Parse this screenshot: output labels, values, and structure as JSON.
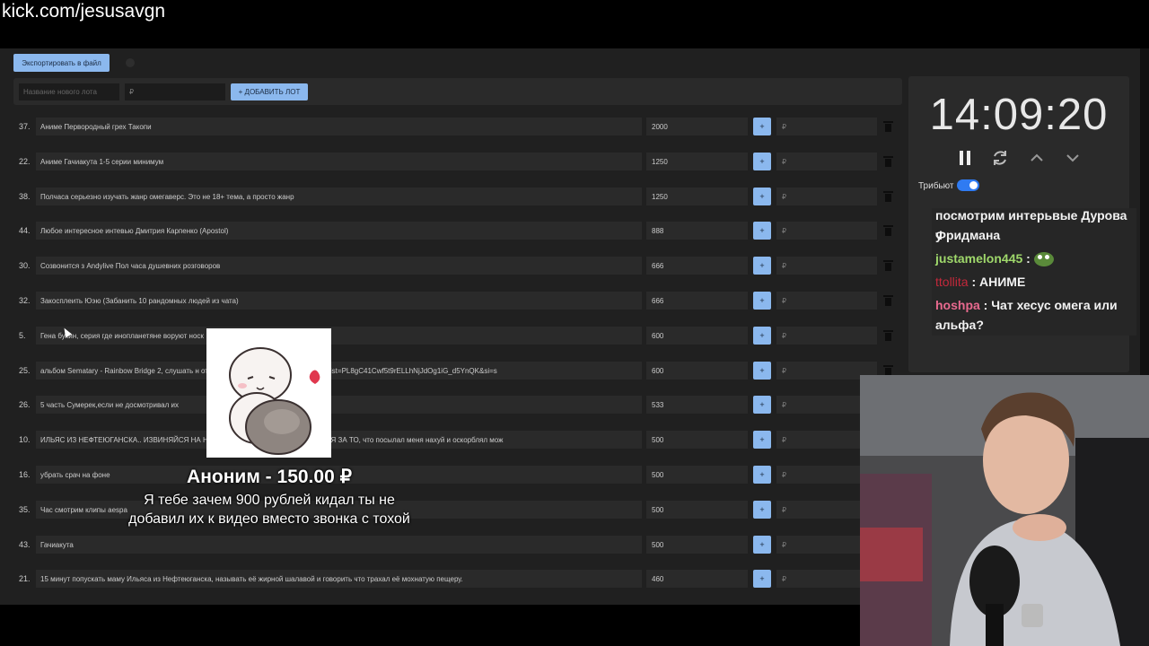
{
  "overlay": {
    "url": "kick.com/jesusavgn"
  },
  "toolbar": {
    "export_label": "Экспортировать в файл"
  },
  "new_lot": {
    "name_placeholder": "Название нового лота",
    "price_placeholder": "₽",
    "add_label": "+ ДОБАВИТЬ ЛОТ"
  },
  "lots": [
    {
      "num": "37.",
      "title": "Аниме Первородный грех Такопи",
      "amount": "2000",
      "plus": "+",
      "add_placeholder": "₽"
    },
    {
      "num": "22.",
      "title": "Аниме Гачиакута 1-5 серии минимум",
      "amount": "1250",
      "plus": "+",
      "add_placeholder": "₽"
    },
    {
      "num": "38.",
      "title": "Полчаса серьезно изучать жанр омегаверс. Это не 18+ тема, а просто жанр",
      "amount": "1250",
      "plus": "+",
      "add_placeholder": "₽"
    },
    {
      "num": "44.",
      "title": "Любое интересное интевью Дмитрия Карпенко (Apostol)",
      "amount": "888",
      "plus": "+",
      "add_placeholder": "₽"
    },
    {
      "num": "30.",
      "title": "Созвонится з Andylive Пол часа душевних розговоров",
      "amount": "666",
      "plus": "+",
      "add_placeholder": "₽"
    },
    {
      "num": "32.",
      "title": "Закосплеить Юэю (Забанить 10 рандомных людей из чата)",
      "amount": "666",
      "plus": "+",
      "add_placeholder": "₽"
    },
    {
      "num": "5.",
      "title": "Гена букин, серия где инопланетяне воруют носк",
      "amount": "600",
      "plus": "+",
      "add_placeholder": "₽"
    },
    {
      "num": "25.",
      "title": "альбом Sematary - Rainbow Bridge 2, слушать н                                        от ссылка: https://youtube.com/playlist?list=PL8gC41Cwf5t9rELLhNjJdOg1iG_d5YnQK&si=s",
      "amount": "600",
      "plus": "+",
      "add_placeholder": "₽"
    },
    {
      "num": "26.",
      "title": "5 часть Сумерек,если не досмотривал их",
      "amount": "533",
      "plus": "+",
      "add_placeholder": "₽"
    },
    {
      "num": "10.",
      "title": "ИЛЬЯС ИЗ НЕФТЕЮГАНСКА.. ИЗВИНЯЙСЯ НА                                       НЕФТЕЮГАНСКА. ПРОСИ ПРОЩЕНИЯ ЗА ТО, что посылал меня нахуй и оскорблял мож",
      "amount": "500",
      "plus": "+",
      "add_placeholder": "₽"
    },
    {
      "num": "16.",
      "title": "убрать срач на фоне",
      "amount": "500",
      "plus": "+",
      "add_placeholder": "₽"
    },
    {
      "num": "35.",
      "title": "Час смотрим клипы aespa",
      "amount": "500",
      "plus": "+",
      "add_placeholder": "₽"
    },
    {
      "num": "43.",
      "title": "Гачиакута",
      "amount": "500",
      "plus": "+",
      "add_placeholder": "₽"
    },
    {
      "num": "21.",
      "title": "15 минут попускать маму Ильяса из Нефтеюганска, называть её жирной шалавой и говорить что трахал её мохнатую пещеру.",
      "amount": "460",
      "plus": "+",
      "add_placeholder": "₽"
    }
  ],
  "timer": {
    "time": "14:09:20",
    "tribute_label": "Трибьют"
  },
  "chat": {
    "partial_top": "посмотрим интерьвые Дурова у",
    "messages": [
      {
        "text": "Фридмана",
        "user": "",
        "color": "#f2f2f2"
      },
      {
        "user": "justamelon445",
        "text": " : ",
        "color": "#9fd86b"
      },
      {
        "user": "ttollita",
        "text": " : АНИМЕ",
        "color": "#c4283b"
      },
      {
        "user": "hoshpa",
        "text": " : Чат хесус омега или",
        "color": "#e86a8f"
      },
      {
        "user": "",
        "text": "альфа?",
        "color": "#f2f2f2"
      }
    ]
  },
  "donation": {
    "title": "Аноним - 150.00 ₽",
    "message": "Я тебе зачем 900 рублей кидал ты не добавил их к видео вместо звонка с тохой"
  },
  "colors": {
    "accent": "#8bb8ee",
    "toggle": "#2f7bf2",
    "panel": "#2a2a2a",
    "bg": "#202020"
  }
}
